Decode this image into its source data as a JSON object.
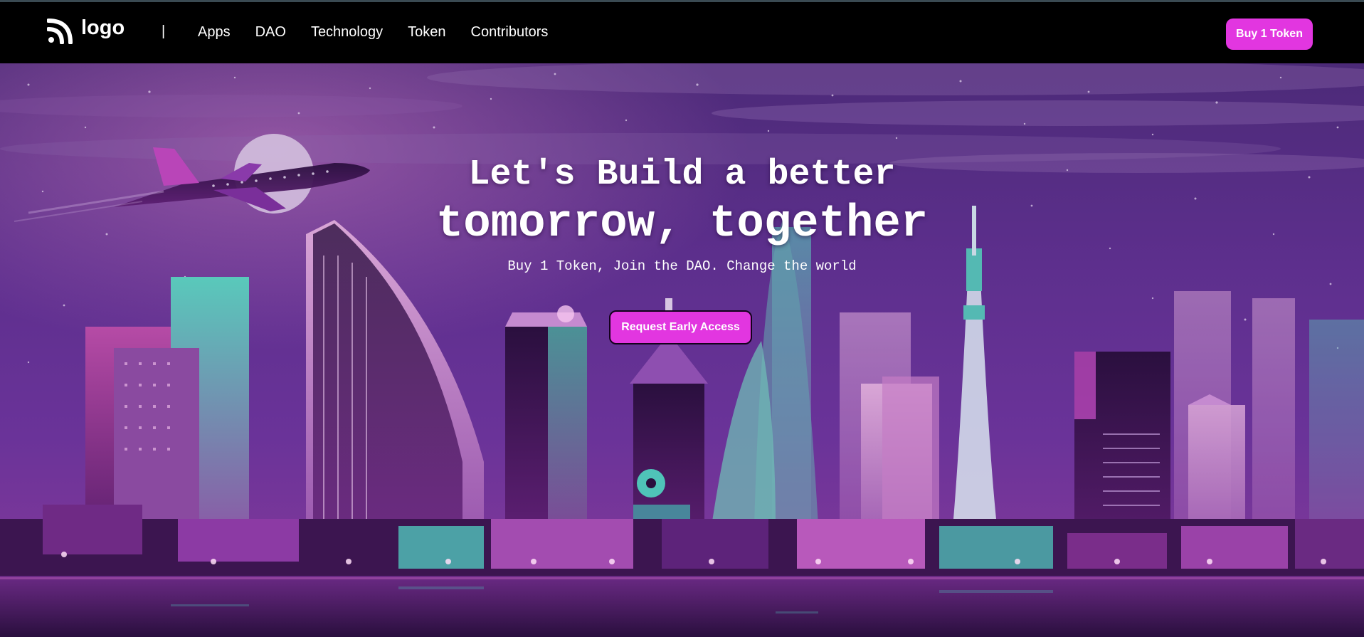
{
  "nav": {
    "logo_text": "logo",
    "separator": "|",
    "links": [
      "Apps",
      "DAO",
      "Technology",
      "Token",
      "Contributors"
    ],
    "buy_button": "Buy 1 Token"
  },
  "hero": {
    "title_line1": "Let's Build a better",
    "title_line2": "tomorrow, together",
    "subtitle": "Buy 1 Token, Join the DAO. Change the world",
    "cta_button": "Request Early Access"
  },
  "colors": {
    "accent": "#e236e0",
    "navbar_bg": "#000000",
    "hero_purple": "#5c2b8a",
    "hero_pink": "#c8359e",
    "hero_teal": "#4fc3b8"
  },
  "icons": {
    "logo": "rss-icon",
    "illustration": "city-skyline-airplane-illustration"
  }
}
